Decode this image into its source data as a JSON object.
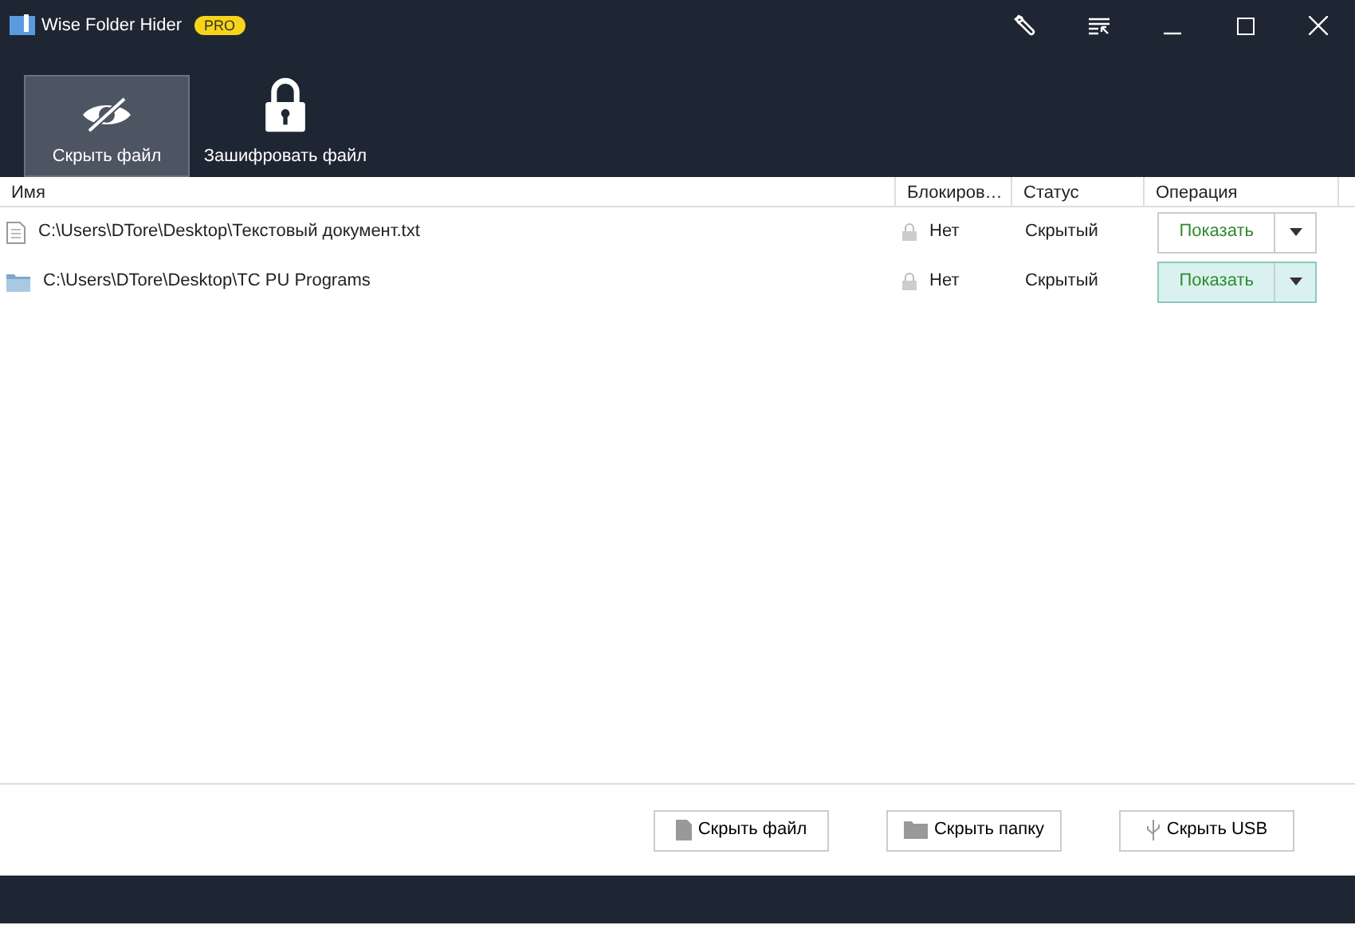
{
  "window": {
    "title": "Wise Folder Hider",
    "badge": "PRO"
  },
  "tabs": [
    {
      "label": "Скрыть файл",
      "kind": "hide",
      "selected": true
    },
    {
      "label": "Зашифровать файл",
      "kind": "encrypt",
      "selected": false
    }
  ],
  "table": {
    "columns": [
      "Имя",
      "Блокиров…",
      "Статус",
      "Операция"
    ],
    "rows": [
      {
        "kind": "file",
        "path": "C:\\Users\\DTore\\Desktop\\Текстовый документ.txt",
        "locked": "Нет",
        "status": "Скрытый",
        "action": "Показать",
        "highlighted": false
      },
      {
        "kind": "folder",
        "path": "C:\\Users\\DTore\\Desktop\\TC PU Programs",
        "locked": "Нет",
        "status": "Скрытый",
        "action": "Показать",
        "highlighted": true
      }
    ]
  },
  "buttons": [
    {
      "kind": "file",
      "label": "Скрыть файл"
    },
    {
      "kind": "folder",
      "label": "Скрыть папку"
    },
    {
      "kind": "usb",
      "label": "Скрыть USB"
    }
  ]
}
